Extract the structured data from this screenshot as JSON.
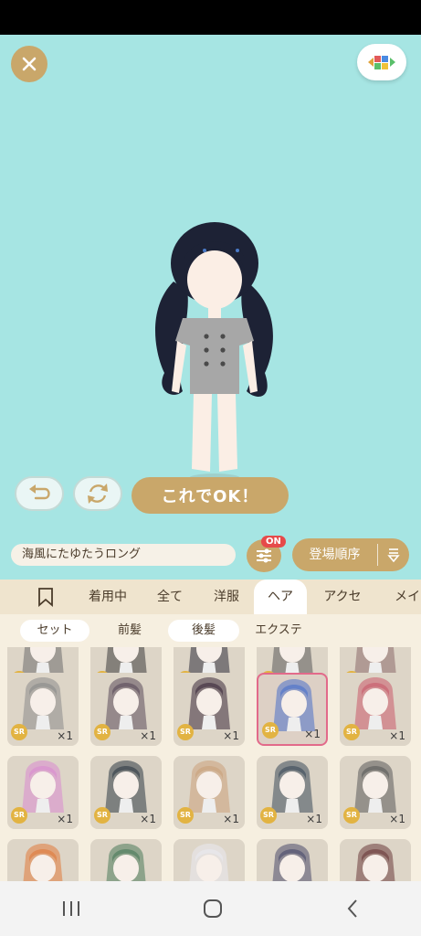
{
  "stage": {
    "background": "#a6e5e3",
    "ok_label": "これでOK！"
  },
  "item_bar": {
    "item_name": "海風にたゆたうロング",
    "filter_badge": "ON",
    "sort_label": "登場順序"
  },
  "tabs": [
    {
      "label": ""
    },
    {
      "label": "着用中"
    },
    {
      "label": "全て"
    },
    {
      "label": "洋服"
    },
    {
      "label": "ヘア"
    },
    {
      "label": "アクセ"
    },
    {
      "label": "メイク"
    }
  ],
  "subtabs": [
    {
      "label": "セット"
    },
    {
      "label": "前髪"
    },
    {
      "label": "後髪"
    },
    {
      "label": "エクステ"
    }
  ],
  "grid": {
    "rarity": "SR",
    "quantity": "×1",
    "items": [
      {
        "hair": "#6b6b6b"
      },
      {
        "hair": "#3b3b3b"
      },
      {
        "hair": "#2e2e3a"
      },
      {
        "hair": "#5a5a5a"
      },
      {
        "hair": "#8a6a6a"
      },
      {
        "hair": "#8a8a8a"
      },
      {
        "hair": "#5a4a5a"
      },
      {
        "hair": "#3a2a3a"
      },
      {
        "hair": "#4a6fc9"
      },
      {
        "hair": "#c85a6a"
      },
      {
        "hair": "#d88ad0"
      },
      {
        "hair": "#2e3a44"
      },
      {
        "hair": "#caa07a"
      },
      {
        "hair": "#3a4a5a"
      },
      {
        "hair": "#5a5a5a"
      },
      {
        "hair": "#e07a3a"
      },
      {
        "hair": "#4a7a5a"
      },
      {
        "hair": "#eaeaf0"
      },
      {
        "hair": "#4a4a6a"
      },
      {
        "hair": "#6a3a3a"
      }
    ]
  },
  "colors": {
    "accent": "#c9a76a",
    "tab_bg": "#efe4ce",
    "selected_border": "#e26a8a",
    "badge_red": "#e64a4a",
    "sr_gold": "#e2b342"
  }
}
